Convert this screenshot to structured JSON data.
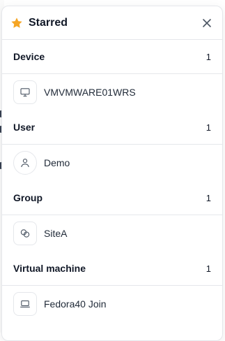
{
  "panel": {
    "title": "Starred",
    "star_icon": "star-icon",
    "close_icon": "close-icon",
    "accent": "#f5a524"
  },
  "sections": [
    {
      "label": "Device",
      "count": "1",
      "items": [
        {
          "label": "VMVMWARE01WRS",
          "icon": "monitor-icon"
        }
      ]
    },
    {
      "label": "User",
      "count": "1",
      "items": [
        {
          "label": "Demo",
          "icon": "user-icon"
        }
      ]
    },
    {
      "label": "Group",
      "count": "1",
      "items": [
        {
          "label": "SiteA",
          "icon": "group-icon"
        }
      ]
    },
    {
      "label": "Virtual machine",
      "count": "1",
      "items": [
        {
          "label": "Fedora40 Join",
          "icon": "laptop-icon"
        }
      ]
    }
  ]
}
